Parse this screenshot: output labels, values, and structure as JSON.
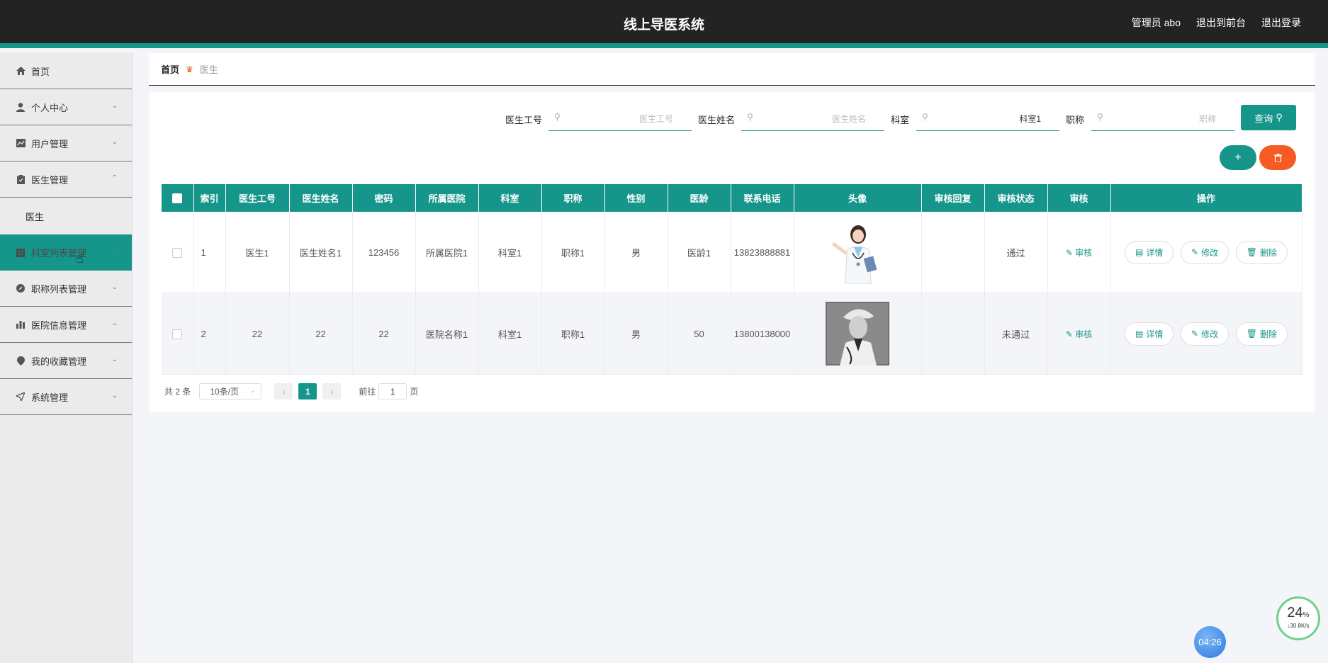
{
  "header": {
    "title": "线上导医系统",
    "admin_label": "管理员 abo",
    "to_front": "退出到前台",
    "logout": "退出登录"
  },
  "sidebar": {
    "items": [
      {
        "label": "首页",
        "icon": "home-icon"
      },
      {
        "label": "个人中心",
        "icon": "user-icon"
      },
      {
        "label": "用户管理",
        "icon": "chart-icon"
      },
      {
        "label": "医生管理",
        "icon": "clipboard-icon"
      },
      {
        "label": "医生",
        "icon": ""
      },
      {
        "label": "科室列表管理",
        "icon": "building-icon"
      },
      {
        "label": "职称列表管理",
        "icon": "compass-icon"
      },
      {
        "label": "医院信息管理",
        "icon": "bar-chart-icon"
      },
      {
        "label": "我的收藏管理",
        "icon": "location-icon"
      },
      {
        "label": "系统管理",
        "icon": "send-icon"
      }
    ]
  },
  "breadcrumb": {
    "home": "首页",
    "current": "医生"
  },
  "search": {
    "doctor_no_label": "医生工号",
    "doctor_no_placeholder": "医生工号",
    "doctor_name_label": "医生姓名",
    "doctor_name_placeholder": "医生姓名",
    "dept_label": "科室",
    "dept_value": "科室1",
    "title_label": "职称",
    "title_placeholder": "职称",
    "query_button": "查询"
  },
  "actions": {
    "add": "+",
    "delete_icon": "trash-icon"
  },
  "table": {
    "headers": [
      "索引",
      "医生工号",
      "医生姓名",
      "密码",
      "所属医院",
      "科室",
      "职称",
      "性别",
      "医龄",
      "联系电话",
      "头像",
      "审核回复",
      "审核状态",
      "审核",
      "操作"
    ],
    "rows": [
      {
        "index": "1",
        "doctor_no": "医生1",
        "doctor_name": "医生姓名1",
        "password": "123456",
        "hospital": "所属医院1",
        "dept": "科室1",
        "title": "职称1",
        "gender": "男",
        "years": "医龄1",
        "phone": "13823888881",
        "reply": "",
        "status": "通过",
        "audit": "审核"
      },
      {
        "index": "2",
        "doctor_no": "22",
        "doctor_name": "22",
        "password": "22",
        "hospital": "医院名称1",
        "dept": "科室1",
        "title": "职称1",
        "gender": "男",
        "years": "50",
        "phone": "13800138000",
        "reply": "",
        "status": "未通过",
        "audit": "审核"
      }
    ],
    "op_detail": "详情",
    "op_edit": "修改",
    "op_delete": "删除"
  },
  "pager": {
    "total": "共 2 条",
    "page_size": "10条/页",
    "current_page": "1",
    "goto_label": "前往",
    "goto_value": "1",
    "page_suffix": "页"
  },
  "widgets": {
    "cpu_percent": "24",
    "percent_sign": "%",
    "net_speed": "↓30.8K/s",
    "clock": "04:26"
  },
  "colors": {
    "accent": "#16958a",
    "danger": "#f55b23",
    "header_bg": "#232323"
  }
}
